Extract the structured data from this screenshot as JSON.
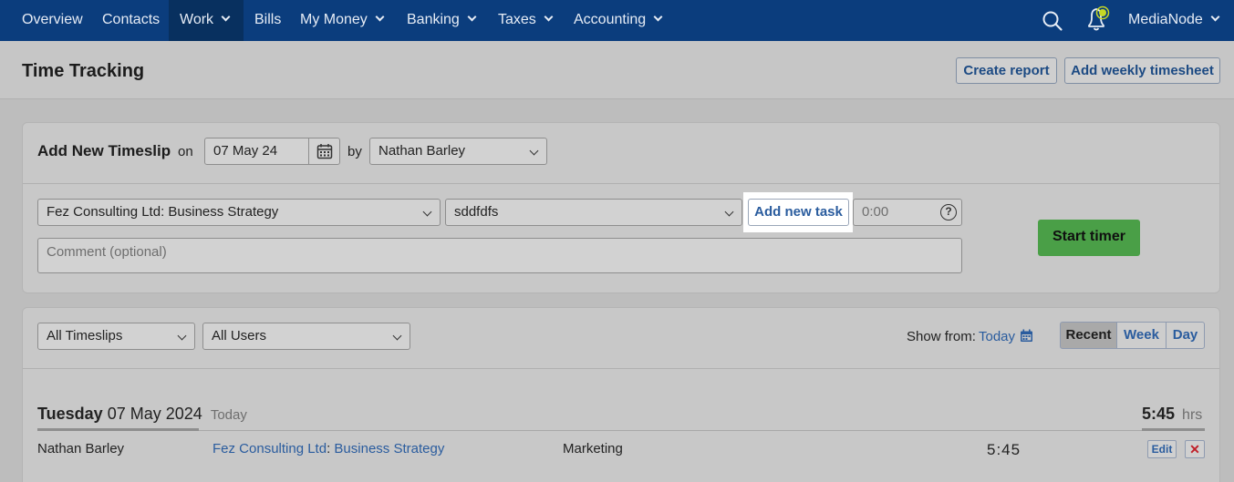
{
  "nav": {
    "items": [
      {
        "label": "Overview"
      },
      {
        "label": "Contacts"
      },
      {
        "label": "Work"
      },
      {
        "label": "Bills"
      },
      {
        "label": "My Money"
      },
      {
        "label": "Banking"
      },
      {
        "label": "Taxes"
      },
      {
        "label": "Accounting"
      }
    ],
    "account": "MediaNode"
  },
  "page": {
    "title": "Time Tracking",
    "create_report": "Create report",
    "add_weekly": "Add weekly timesheet"
  },
  "timeslip": {
    "heading": "Add New Timeslip",
    "on_label": "on",
    "date": "07 May 24",
    "by_label": "by",
    "user": "Nathan Barley",
    "project": "Fez Consulting Ltd: Business Strategy",
    "task": "sddfdfs",
    "add_task": "Add new task",
    "time_placeholder": "0:00",
    "comment_placeholder": "Comment (optional)",
    "start_timer": "Start timer",
    "help_glyph": "?"
  },
  "list": {
    "filter_timeslips": "All Timeslips",
    "filter_users": "All Users",
    "show_from_label": "Show from:",
    "show_from_value": "Today",
    "views": [
      "Recent",
      "Week",
      "Day"
    ],
    "day_group": {
      "weekday": "Tuesday",
      "date": "07 May 2024",
      "tag": "Today",
      "total": "5:45",
      "unit": "hrs"
    },
    "rows": [
      {
        "user": "Nathan Barley",
        "contact": "Fez Consulting Ltd",
        "separator": ":",
        "project": "Business Strategy",
        "task": "Marketing",
        "hours": "5:45",
        "edit": "Edit",
        "delete": "✕"
      }
    ]
  },
  "colors": {
    "nav_bg": "#0b3d7d",
    "link": "#2a5c9e",
    "start_timer": "#4a9f47",
    "delete": "#c0202a",
    "notification_dot": "#c7d825"
  }
}
